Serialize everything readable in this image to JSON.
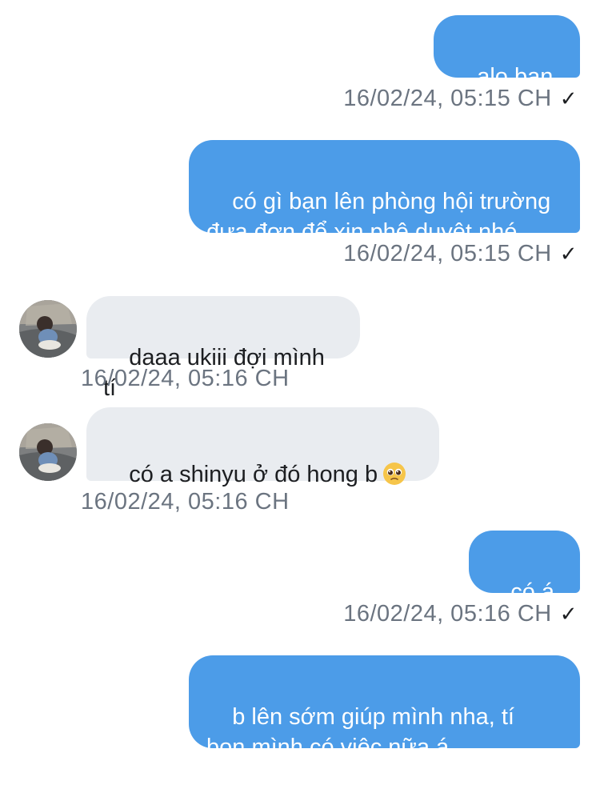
{
  "messages": [
    {
      "direction": "outgoing",
      "text": "alo bạn ơi",
      "time": "16/02/24, 05:15 CH",
      "status": "✓"
    },
    {
      "direction": "outgoing",
      "text": "có gì bạn lên phòng hội trường\nđưa đơn để xin phê duyệt nhé",
      "time": "16/02/24, 05:15 CH",
      "status": "✓"
    },
    {
      "direction": "incoming",
      "text": "daaa ukiii đợi mình tí",
      "time": "16/02/24, 05:16 CH"
    },
    {
      "direction": "incoming",
      "text": "có a shinyu ở đó hong b",
      "emoji": "pleading-face-emoji",
      "time": "16/02/24, 05:16 CH"
    },
    {
      "direction": "outgoing",
      "text": "có á b",
      "time": "16/02/24, 05:16 CH",
      "status": "✓"
    },
    {
      "direction": "outgoing",
      "text": "b lên sớm giúp mình nha, tí\nbọn mình có việc nữa á"
    }
  ],
  "colors": {
    "outgoing_bubble": "#4c9ce8",
    "incoming_bubble": "#e9ecf0",
    "timestamp": "#6b7480"
  }
}
